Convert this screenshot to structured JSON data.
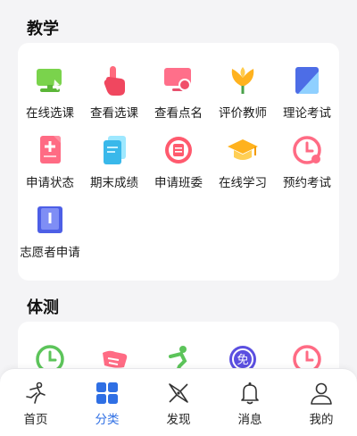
{
  "sections": [
    {
      "title": "教学",
      "items": [
        {
          "label": "在线选课",
          "icon": "monitor-book-icon"
        },
        {
          "label": "查看选课",
          "icon": "hand-pointer-icon"
        },
        {
          "label": "查看点名",
          "icon": "monitor-person-icon"
        },
        {
          "label": "评价教师",
          "icon": "tulip-icon"
        },
        {
          "label": "理论考试",
          "icon": "notebook-icon"
        },
        {
          "label": "申请状态",
          "icon": "document-plus-icon"
        },
        {
          "label": "期末成绩",
          "icon": "stacked-docs-icon"
        },
        {
          "label": "申请班委",
          "icon": "badge-doc-icon"
        },
        {
          "label": "在线学习",
          "icon": "graduation-cap-icon"
        },
        {
          "label": "预约考试",
          "icon": "clock-check-icon"
        },
        {
          "label": "志愿者申请",
          "icon": "open-book-icon"
        }
      ]
    },
    {
      "title": "体测",
      "items": [
        {
          "label": "",
          "icon": "clock-green-icon"
        },
        {
          "label": "",
          "icon": "shoe-icon"
        },
        {
          "label": "",
          "icon": "runner-icon"
        },
        {
          "label": "",
          "icon": "exempt-badge-icon"
        },
        {
          "label": "",
          "icon": "clock-red-icon"
        }
      ]
    }
  ],
  "tabbar": {
    "active": "分类",
    "tabs": [
      {
        "label": "首页",
        "icon": "runner-outline-icon"
      },
      {
        "label": "分类",
        "icon": "grid-icon"
      },
      {
        "label": "发现",
        "icon": "compass-icon"
      },
      {
        "label": "消息",
        "icon": "bell-icon"
      },
      {
        "label": "我的",
        "icon": "user-icon"
      }
    ]
  },
  "colors": {
    "accent": "#2f6fe4",
    "page_bg": "#f4f4f6",
    "card_bg": "#ffffff"
  }
}
